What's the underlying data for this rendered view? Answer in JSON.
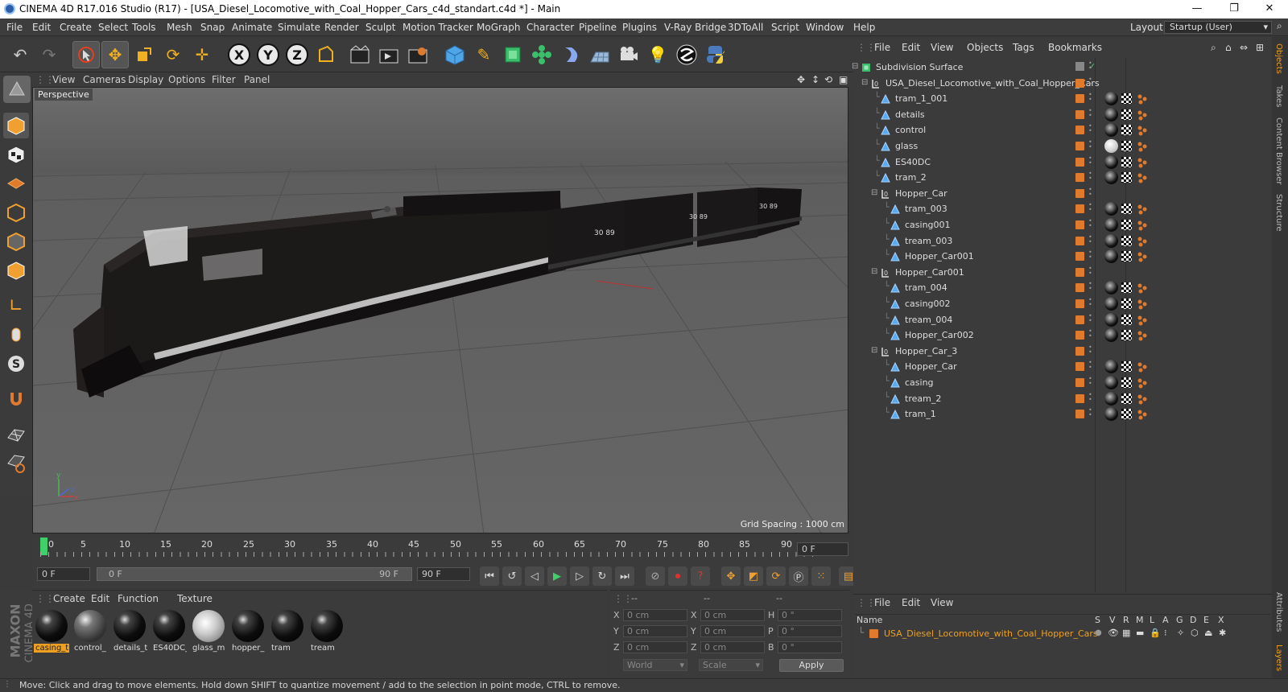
{
  "window": {
    "title": "CINEMA 4D R17.016 Studio (R17) - [USA_Diesel_Locomotive_with_Coal_Hopper_Cars_c4d_standart.c4d *] - Main",
    "minimize": "—",
    "maximize": "❐",
    "close": "✕"
  },
  "menubar": {
    "items": [
      "File",
      "Edit",
      "Create",
      "Select",
      "Tools",
      "Mesh",
      "Snap",
      "Animate",
      "Simulate",
      "Render",
      "Sculpt",
      "Motion Tracker",
      "MoGraph",
      "Character",
      "Pipeline",
      "Plugins",
      "V-Ray Bridge",
      "3DToAll",
      "Script",
      "Window",
      "Help"
    ],
    "layout_label": "Layout:",
    "layout_value": "Startup (User)"
  },
  "viewport": {
    "menu": [
      "View",
      "Cameras",
      "Display",
      "Options",
      "Filter",
      "Panel"
    ],
    "camera_label": "Perspective",
    "grid_spacing": "Grid Spacing : 1000 cm",
    "car_numbers": [
      "30 89",
      "30 89",
      "30 89"
    ],
    "axis_labels": {
      "y": "y",
      "z": "z",
      "x": "x"
    }
  },
  "timeline": {
    "ticks": [
      "0",
      "5",
      "10",
      "15",
      "20",
      "25",
      "30",
      "35",
      "40",
      "45",
      "50",
      "55",
      "60",
      "65",
      "70",
      "75",
      "80",
      "85",
      "90"
    ],
    "current_frame_right": "0 F",
    "frame_start": "0 F",
    "range_start": "0 F",
    "range_end": "90 F",
    "frame_end": "90 F"
  },
  "material_manager": {
    "menu": [
      "Create",
      "Edit",
      "Function",
      "Texture"
    ],
    "materials": [
      {
        "label": "casing_t",
        "selected": true
      },
      {
        "label": "control_",
        "selected": false
      },
      {
        "label": "details_t",
        "selected": false
      },
      {
        "label": "ES40DC_",
        "selected": false
      },
      {
        "label": "glass_m",
        "selected": false
      },
      {
        "label": "hopper_",
        "selected": false
      },
      {
        "label": "tram",
        "selected": false
      },
      {
        "label": "tream",
        "selected": false
      }
    ]
  },
  "coord_manager": {
    "headers": [
      "--",
      "--",
      "--"
    ],
    "rows": [
      {
        "a": "X",
        "av": "0 cm",
        "b": "X",
        "bv": "0 cm",
        "c": "H",
        "cv": "0 °"
      },
      {
        "a": "Y",
        "av": "0 cm",
        "b": "Y",
        "bv": "0 cm",
        "c": "P",
        "cv": "0 °"
      },
      {
        "a": "Z",
        "av": "0 cm",
        "b": "Z",
        "bv": "0 cm",
        "c": "B",
        "cv": "0 °"
      }
    ],
    "world": "World",
    "scale": "Scale",
    "apply": "Apply"
  },
  "object_manager": {
    "menu": [
      "File",
      "Edit",
      "View",
      "Objects",
      "Tags",
      "Bookmarks"
    ],
    "objects": [
      {
        "name": "Subdivision Surface",
        "level": 0,
        "type": "subdiv",
        "tags": "none"
      },
      {
        "name": "USA_Diesel_Locomotive_with_Coal_Hopper_Cars",
        "level": 1,
        "type": "null",
        "tags": "none"
      },
      {
        "name": "tram_1_001",
        "level": 2,
        "type": "poly",
        "tags": "full"
      },
      {
        "name": "details",
        "level": 2,
        "type": "poly",
        "tags": "full"
      },
      {
        "name": "control",
        "level": 2,
        "type": "poly",
        "tags": "full"
      },
      {
        "name": "glass",
        "level": 2,
        "type": "poly",
        "tags": "glass"
      },
      {
        "name": "ES40DC",
        "level": 2,
        "type": "poly",
        "tags": "full"
      },
      {
        "name": "tram_2",
        "level": 2,
        "type": "poly",
        "tags": "full"
      },
      {
        "name": "Hopper_Car",
        "level": 2,
        "type": "null",
        "tags": "none"
      },
      {
        "name": "tram_003",
        "level": 3,
        "type": "poly",
        "tags": "full"
      },
      {
        "name": "casing001",
        "level": 3,
        "type": "poly",
        "tags": "full"
      },
      {
        "name": "tream_003",
        "level": 3,
        "type": "poly",
        "tags": "full"
      },
      {
        "name": "Hopper_Car001",
        "level": 3,
        "type": "poly",
        "tags": "full"
      },
      {
        "name": "Hopper_Car001",
        "level": 2,
        "type": "null",
        "tags": "none"
      },
      {
        "name": "tram_004",
        "level": 3,
        "type": "poly",
        "tags": "full"
      },
      {
        "name": "casing002",
        "level": 3,
        "type": "poly",
        "tags": "full"
      },
      {
        "name": "tream_004",
        "level": 3,
        "type": "poly",
        "tags": "full"
      },
      {
        "name": "Hopper_Car002",
        "level": 3,
        "type": "poly",
        "tags": "full"
      },
      {
        "name": "Hopper_Car_3",
        "level": 2,
        "type": "null",
        "tags": "none"
      },
      {
        "name": "Hopper_Car",
        "level": 3,
        "type": "poly",
        "tags": "full"
      },
      {
        "name": "casing",
        "level": 3,
        "type": "poly",
        "tags": "full"
      },
      {
        "name": "tream_2",
        "level": 3,
        "type": "poly",
        "tags": "full"
      },
      {
        "name": "tram_1",
        "level": 3,
        "type": "poly",
        "tags": "full"
      }
    ]
  },
  "attribute_manager": {
    "menu": [
      "File",
      "Edit",
      "View"
    ],
    "col_name": "Name",
    "cols": [
      "S",
      "V",
      "R",
      "M",
      "L",
      "A",
      "G",
      "D",
      "E",
      "X"
    ],
    "row_name": "USA_Diesel_Locomotive_with_Coal_Hopper_Cars"
  },
  "side_tabs": [
    "Objects",
    "Takes",
    "Content Browser",
    "Structure"
  ],
  "side_tabs_bottom": [
    "Attributes",
    "Layers"
  ],
  "logo": {
    "line1": "MAXON",
    "line2": "CINEMA 4D"
  },
  "status": "Move: Click and drag to move elements. Hold down SHIFT to quantize movement / add to the selection in point mode, CTRL to remove.",
  "colors": {
    "accent": "#e07a2c",
    "selected_text": "#f0a020",
    "viewport_bg": "#6a6a6a",
    "panel": "#3b3b3b"
  }
}
